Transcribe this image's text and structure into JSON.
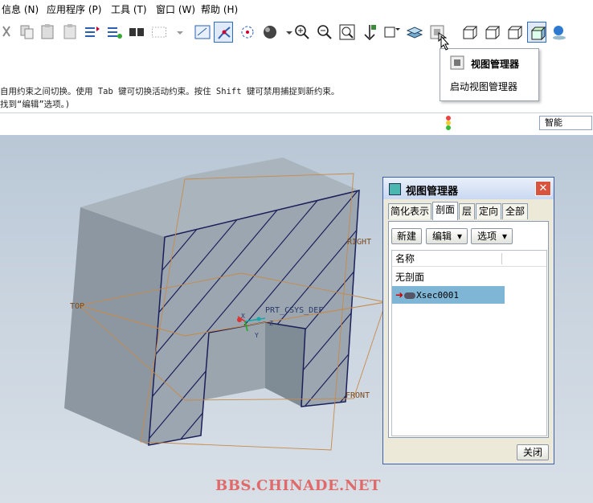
{
  "menubar": {
    "items": [
      {
        "label": "信息 (N)"
      },
      {
        "label": "应用程序 (P)"
      },
      {
        "label": "工具 (T)"
      },
      {
        "label": "窗口 (W)"
      },
      {
        "label": "帮助 (H)"
      }
    ]
  },
  "toolbar": {
    "icons": [
      "cut-icon",
      "copy-icon",
      "paste-icon",
      "paste-special-icon",
      "regenerate-icon",
      "regenerate-manager-icon",
      "find-icon",
      "select-box-icon",
      "dropdown-icon",
      "sketch-view-icon",
      "datum-display-icon",
      "spin-center-icon",
      "shading-icon",
      "dropdown-icon",
      "zoom-in-icon",
      "zoom-out-icon",
      "refit-icon",
      "reorient-icon",
      "saved-views-icon",
      "layers-icon",
      "view-manager-icon",
      "wireframe-icon",
      "hidden-line-icon",
      "no-hidden-icon",
      "shaded-icon",
      "enhanced-realism-icon"
    ]
  },
  "tooltip": {
    "title": "视图管理器",
    "description": "启动视图管理器"
  },
  "messages": {
    "line1": "自用约束之间切换。使用 Tab 键可切换活动约束。按住 Shift 键可禁用捕捉到新约束。",
    "line2": "找到“编辑”选项。)"
  },
  "filter": {
    "value": "智能"
  },
  "viewport": {
    "labels": {
      "top": "TOP",
      "right": "RIGHT",
      "front": "FRONT",
      "csys": "PRT_CSYS_DEF",
      "axis_x": "X",
      "axis_y": "Y",
      "axis_z": "Z"
    }
  },
  "dialog": {
    "title": "视图管理器",
    "close_glyph": "✕",
    "tabs": [
      "简化表示",
      "剖面",
      "层",
      "定向",
      "全部"
    ],
    "active_tab": "剖面",
    "buttons": {
      "new": "新建",
      "edit": "编辑",
      "options": "选项"
    },
    "list": {
      "header": "名称",
      "rows": [
        "无剖面",
        "Xsec0001"
      ]
    },
    "close_button": "关闭"
  },
  "watermark": "BBS.CHINADE.NET",
  "colors": {
    "accent": "#2a6cc8",
    "selection": "#7fb6d6",
    "watermark": "#e06a6a",
    "plane": "#c78a4a"
  }
}
